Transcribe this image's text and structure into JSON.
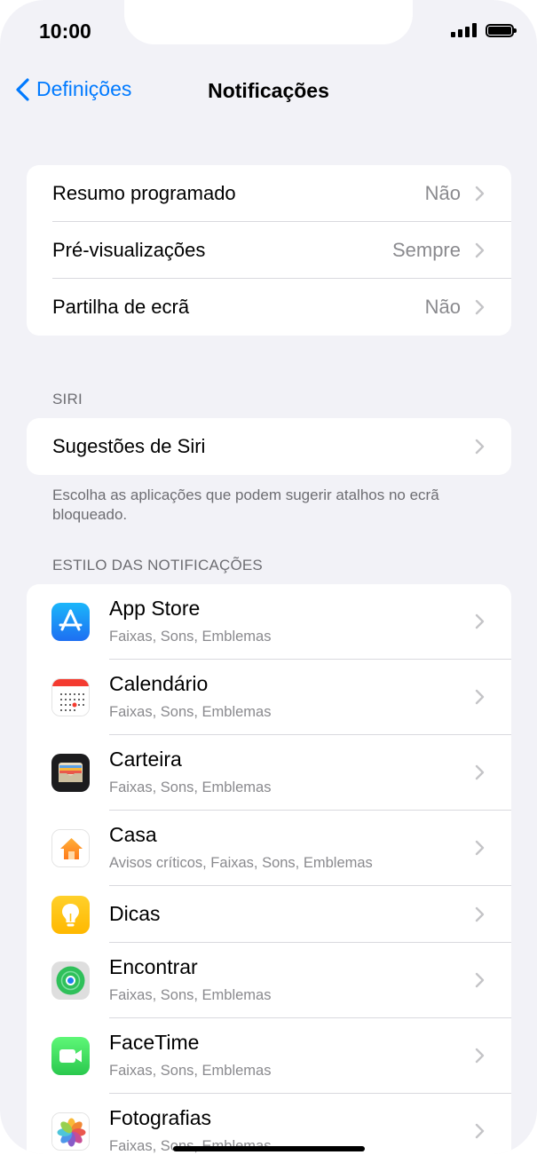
{
  "status": {
    "time": "10:00"
  },
  "nav": {
    "back_label": "Definições",
    "title": "Notificações"
  },
  "settings": [
    {
      "label": "Resumo programado",
      "value": "Não"
    },
    {
      "label": "Pré-visualizações",
      "value": "Sempre"
    },
    {
      "label": "Partilha de ecrã",
      "value": "Não"
    }
  ],
  "siri": {
    "header": "SIRI",
    "row_label": "Sugestões de Siri",
    "footer": "Escolha as aplicações que podem sugerir atalhos no ecrã bloqueado."
  },
  "style_section": {
    "header": "ESTILO DAS NOTIFICAÇÕES"
  },
  "apps": [
    {
      "name": "App Store",
      "sub": "Faixas, Sons, Emblemas",
      "icon": "app-store-icon"
    },
    {
      "name": "Calendário",
      "sub": "Faixas, Sons, Emblemas",
      "icon": "calendar-icon"
    },
    {
      "name": "Carteira",
      "sub": "Faixas, Sons, Emblemas",
      "icon": "wallet-icon"
    },
    {
      "name": "Casa",
      "sub": "Avisos críticos, Faixas, Sons, Emblemas",
      "icon": "home-icon"
    },
    {
      "name": "Dicas",
      "sub": "",
      "icon": "tips-icon"
    },
    {
      "name": "Encontrar",
      "sub": "Faixas, Sons, Emblemas",
      "icon": "find-my-icon"
    },
    {
      "name": "FaceTime",
      "sub": "Faixas, Sons, Emblemas",
      "icon": "facetime-icon"
    },
    {
      "name": "Fotografias",
      "sub": "Faixas, Sons, Emblemas",
      "icon": "photos-icon"
    }
  ],
  "colors": {
    "accent": "#007aff",
    "background": "#f2f2f7",
    "secondary_text": "#8a8a8e"
  }
}
